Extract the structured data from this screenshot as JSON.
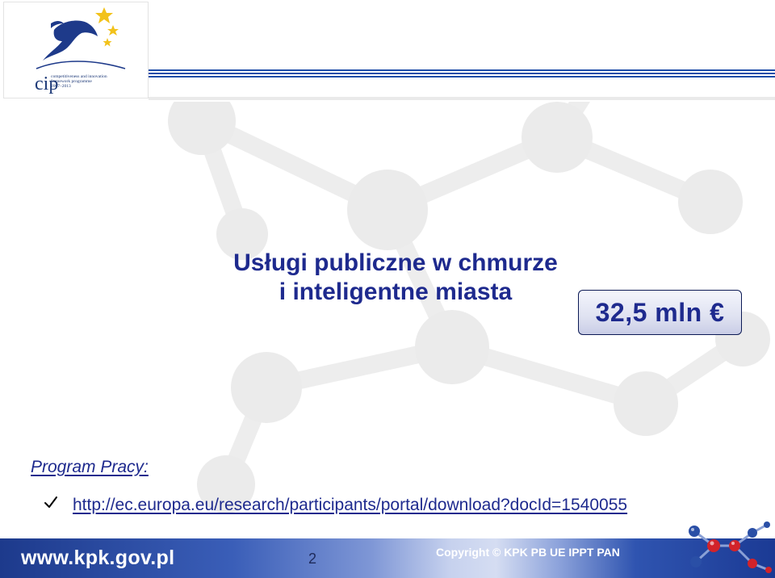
{
  "header": {
    "logo_text": "cip",
    "logo_tagline": [
      "competitiveness and innovation",
      "framework programme",
      "2007–2013"
    ]
  },
  "slide": {
    "title_line1": "Usługi publiczne w chmurze",
    "title_line2": "i inteligentne miasta",
    "amount": "32,5 mln €",
    "program_label": "Program Pracy:",
    "program_link": "http://ec.europa.eu/research/participants/portal/download?docId=1540055"
  },
  "footer": {
    "website": "www.kpk.gov.pl",
    "page_number": "2",
    "copyright": "Copyright ©   KPK PB UE IPPT PAN"
  },
  "colors": {
    "title": "#1e2a8e",
    "header_rule": "#1f4da8",
    "footer_dark": "#1d3a8c",
    "molecule_red": "#d2232a",
    "molecule_blue": "#2a4fa6"
  },
  "icons": [
    "cip-logo-icon",
    "stars-icon",
    "check-icon",
    "molecule-logo-icon"
  ]
}
